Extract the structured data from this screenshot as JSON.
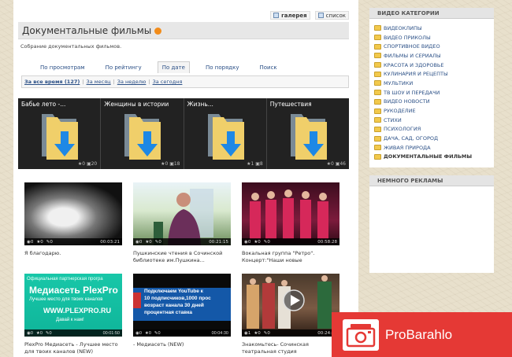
{
  "view_switch": {
    "gallery": "галерея",
    "list": "список"
  },
  "page": {
    "title": "Документальные фильмы",
    "description": "Собрание документальных фильмов."
  },
  "tabs": [
    "По просмотрам",
    "По рейтингу",
    "По дате",
    "По порядку",
    "Поиск"
  ],
  "active_tab": "По дате",
  "filters": [
    "За все время (127)",
    "За месяц",
    "За неделю",
    "За сегодня"
  ],
  "categories": [
    {
      "label": "Бабье лето -...",
      "stars": "0",
      "count": "20"
    },
    {
      "label": "Женщины в истории",
      "stars": "0",
      "count": "18"
    },
    {
      "label": "Жизнь...",
      "stars": "1",
      "count": "8"
    },
    {
      "label": "Путешествия",
      "stars": "0",
      "count": "46"
    }
  ],
  "videos": [
    {
      "title": "Я благодарю.",
      "views": "0",
      "stars": "0",
      "comments": "0",
      "duration": "00:03:21"
    },
    {
      "title": "Пушкинские чтения в Сочинской библиотеке им.Пушкина...",
      "views": "0",
      "stars": "0",
      "comments": "0",
      "duration": "00:21:15"
    },
    {
      "title": "Вокальная группа \"Ретро\". Концерт:\"Наши новые",
      "views": "0",
      "stars": "0",
      "comments": "0",
      "duration": "00:58:28"
    },
    {
      "title": "PlexPro Медиасеть - Лучшее место для твоих каналов (NEW)",
      "views": "0",
      "stars": "0",
      "comments": "0",
      "duration": "00:01:50",
      "overlay_top": "Официальная партнерская програ",
      "overlay_main": "Медиасеть PlexPro",
      "overlay_sub": "Лучшее место для твоих каналов",
      "overlay_url": "WWW.PLEXPRO.RU",
      "overlay_foot": "Давай к нам!"
    },
    {
      "title": "- Медиасеть (NEW)",
      "views": "0",
      "stars": "0",
      "comments": "0",
      "duration": "00:04:30",
      "overlay_lines": [
        "Подключаем YouTube к",
        "10 подписчиков,1000 прос",
        "возраст канала 30 дней",
        "процентная ставка"
      ]
    },
    {
      "title": "Знакомьтесь- Сочинская театральная студия",
      "views": "1",
      "stars": "0",
      "comments": "0",
      "duration": "00:24:55"
    }
  ],
  "sidebar": {
    "categories_title": "ВИДЕО КАТЕГОРИИ",
    "categories": [
      "ВИДЕОКЛИПЫ",
      "ВИДЕО ПРИКОЛЫ",
      "СПОРТИВНОЕ ВИДЕО",
      "ФИЛЬМЫ И СЕРИАЛЫ",
      "КРАСОТА И ЗДОРОВЬЕ",
      "КУЛИНАРИЯ И РЕЦЕПТЫ",
      "МУЛЬТИКИ",
      "ТВ ШОУ И ПЕРЕДАЧИ",
      "ВИДЕО НОВОСТИ",
      "РУКОДЕЛИЕ",
      "СТИХИ",
      "ПСИХОЛОГИЯ",
      "ДАЧА, САД, ОГОРОД",
      "ЖИВАЯ ПРИРОДА",
      "ДОКУМЕНТАЛЬНЫЕ ФИЛЬМЫ"
    ],
    "active_category": "ДОКУМЕНТАЛЬНЫЕ ФИЛЬМЫ",
    "ads_title": "НЕМНОГО РЕКЛАМЫ"
  },
  "promo": {
    "text": "ProBarahlo"
  },
  "colors": {
    "link": "#2a4f86",
    "promo": "#e53935",
    "folder": "#f2c94c"
  }
}
